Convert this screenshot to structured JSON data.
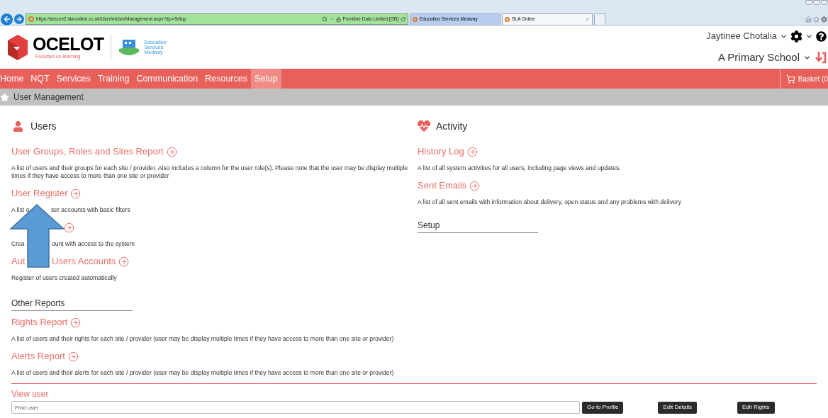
{
  "browser": {
    "url": "https://secure2.sla-online.co.uk/User/mUserManagement.aspx?&p=Setup",
    "site_identity": "Frontline Data Limited [GB]",
    "tabs": [
      {
        "label": "Education Services Medway",
        "selected": false
      },
      {
        "label": "SLA Online",
        "selected": true
      }
    ]
  },
  "header": {
    "brand": "OCELOT",
    "tagline": "Focused on learning",
    "partner": [
      "Education",
      "Services",
      "Medway"
    ],
    "user": "Jaytinee Chotalia",
    "school": "A Primary School"
  },
  "nav": {
    "items": [
      {
        "label": "Home",
        "selected": false
      },
      {
        "label": "NQT",
        "selected": false
      },
      {
        "label": "Services",
        "selected": false
      },
      {
        "label": "Training",
        "selected": false
      },
      {
        "label": "Communication",
        "selected": false
      },
      {
        "label": "Resources",
        "selected": false
      },
      {
        "label": "Setup",
        "selected": true
      }
    ],
    "basket": "Basket (0"
  },
  "breadcrumb": "User Management",
  "users": {
    "title": "Users",
    "links": [
      {
        "title_parts": [
          "User Groups, Roles and Sites Report"
        ],
        "desc_parts": [
          "A list of users and their groups for each site / provider. Also includes a column for the user role(s). Please note that the user may be display multiple times if they have access to more than one site or provider"
        ]
      },
      {
        "title_parts": [
          "User Register"
        ],
        "desc_parts": [
          "A list o",
          "ser accounts with basic filters"
        ]
      },
      {
        "desc_parts": [
          "Crea",
          "ount with access to the system"
        ]
      },
      {
        "title_parts": [
          "Aut",
          "Users Accounts"
        ],
        "desc_parts": [
          "Register of users created automatically"
        ]
      }
    ]
  },
  "activity": {
    "title": "Activity",
    "links": [
      {
        "title_parts": [
          "History Log"
        ],
        "desc_parts": [
          "A list of all system activities for all users, including page views and updates."
        ]
      },
      {
        "title_parts": [
          "Sent Emails"
        ],
        "desc_parts": [
          "A list of all sent emails with information about delivery, open status and any problems with delivery"
        ]
      }
    ]
  },
  "setup": {
    "title": "Setup"
  },
  "other_reports": {
    "title": "Other Reports",
    "links": [
      {
        "title_parts": [
          "Rights Report"
        ],
        "desc_parts": [
          "A list of users and their rights for each site / provider (user may be display multiple times if they have access to more than one site or provider)"
        ]
      },
      {
        "title_parts": [
          "Alerts Report"
        ],
        "desc_parts": [
          "A list of users and their alerts for each site / provider (user may be display multiple times if they have access to more than one site or provider)"
        ]
      }
    ]
  },
  "view_user": {
    "title": "View user",
    "placeholder": "Find user",
    "buttons": [
      "Go to Profile",
      "Edit Details",
      "Edit Rights"
    ]
  }
}
